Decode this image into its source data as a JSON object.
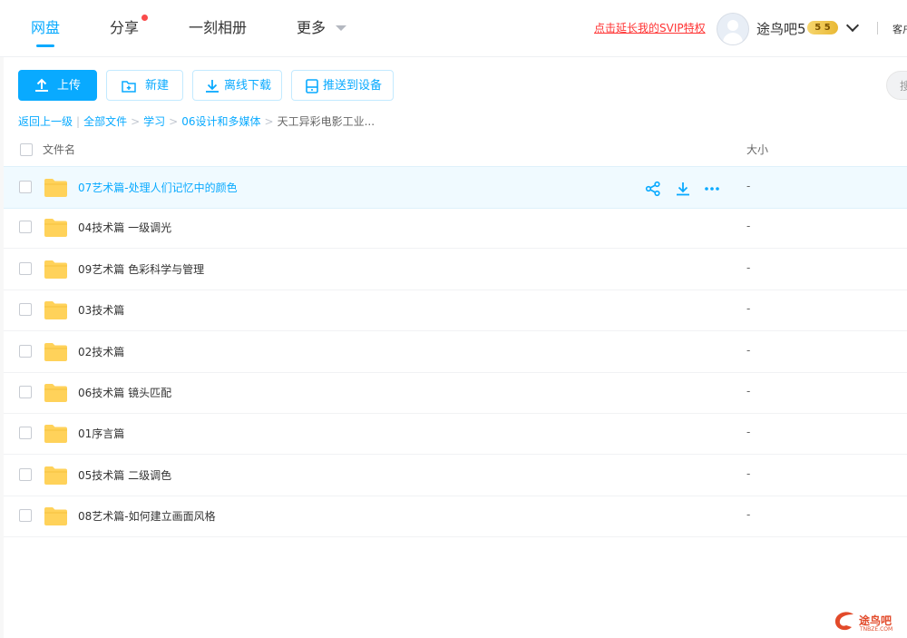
{
  "nav": {
    "tabs": [
      "网盘",
      "分享",
      "一刻相册",
      "更多"
    ],
    "svip_link": "点击延长我的SVIP特权",
    "username": "途鸟吧5",
    "badge": "5 5",
    "service": "客户"
  },
  "toolbar": {
    "upload": "上传",
    "new": "新建",
    "offline": "离线下载",
    "push": "推送到设备",
    "search_placeholder": "搜"
  },
  "breadcrumb": {
    "back": "返回上一级",
    "items": [
      "全部文件",
      "学习",
      "06设计和多媒体"
    ],
    "current": "天工异彩电影工业..."
  },
  "table": {
    "col_name": "文件名",
    "col_size": "大小",
    "rows": [
      {
        "name": "07艺术篇-处理人们记忆中的颜色",
        "size": "-"
      },
      {
        "name": "04技术篇 一级调光",
        "size": "-"
      },
      {
        "name": "09艺术篇 色彩科学与管理",
        "size": "-"
      },
      {
        "name": "03技术篇",
        "size": "-"
      },
      {
        "name": "02技术篇",
        "size": "-"
      },
      {
        "name": "06技术篇 镜头匹配",
        "size": "-"
      },
      {
        "name": "01序言篇",
        "size": "-"
      },
      {
        "name": "05技术篇 二级调色",
        "size": "-"
      },
      {
        "name": "08艺术篇-如何建立画面风格",
        "size": "-"
      }
    ]
  },
  "watermark": {
    "text": "途鸟吧",
    "sub": "TNBZE.COM"
  },
  "colors": {
    "accent": "#09aaff",
    "alert": "#ff3333",
    "folder": "#ffd25a"
  }
}
